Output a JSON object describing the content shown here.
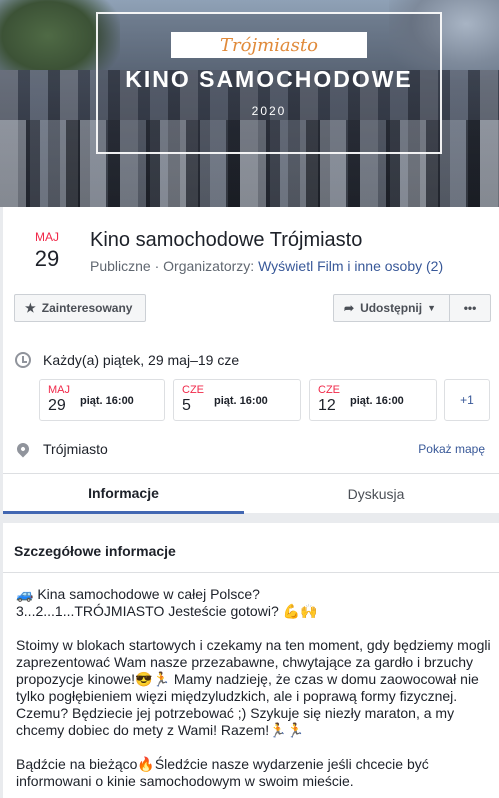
{
  "cover": {
    "banner_text": "Trójmiasto",
    "headline": "KINO SAMOCHODOWE",
    "year": "2020"
  },
  "event": {
    "month": "MAJ",
    "day": "29",
    "title": "Kino samochodowe Trójmiasto",
    "privacy": "Publiczne",
    "organizers_label": "Organizatorzy:",
    "organizer": "Wyświetl Film",
    "others": "i inne osoby (2)"
  },
  "actions": {
    "interested_label": "Zainteresowany",
    "share_label": "Udostępnij",
    "more_label": "•••"
  },
  "schedule": {
    "summary": "Każdy(a) piątek, 29 maj–19 cze",
    "occurrences": [
      {
        "month": "MAJ",
        "day": "29",
        "time": "piąt. 16:00"
      },
      {
        "month": "CZE",
        "day": "5",
        "time": "piąt. 16:00"
      },
      {
        "month": "CZE",
        "day": "12",
        "time": "piąt. 16:00"
      }
    ],
    "more": "+1"
  },
  "location": {
    "name": "Trójmiasto",
    "map_link": "Pokaż mapę"
  },
  "tabs": {
    "info": "Informacje",
    "discussion": "Dyskusja"
  },
  "details": {
    "heading": "Szczegółowe informacje",
    "line1": "🚙  Kina samochodowe w całej Polsce?",
    "line2": " 3...2...1...TRÓJMIASTO Jesteście gotowi? 💪🙌",
    "para2": " Stoimy w blokach startowych i czekamy na ten moment, gdy będziemy mogli zaprezentować Wam nasze przezabawne, chwytające za gardło i brzuchy propozycje kinowe!😎🏃 Mamy nadzieję, że czas w domu zaowocował nie tylko pogłębieniem więzi międzyludzkich, ale i poprawą formy fizycznej. Czemu? Będziecie jej potrzebować ;) Szykuje się niezły maraton, a my chcemy dobiec do mety z Wami! Razem!🏃🏃",
    "para3": " Bądźcie na bieżąco🔥Śledźcie nasze wydarzenie jeśli chcecie być informowani o kinie samochodowym w swoim mieście."
  }
}
